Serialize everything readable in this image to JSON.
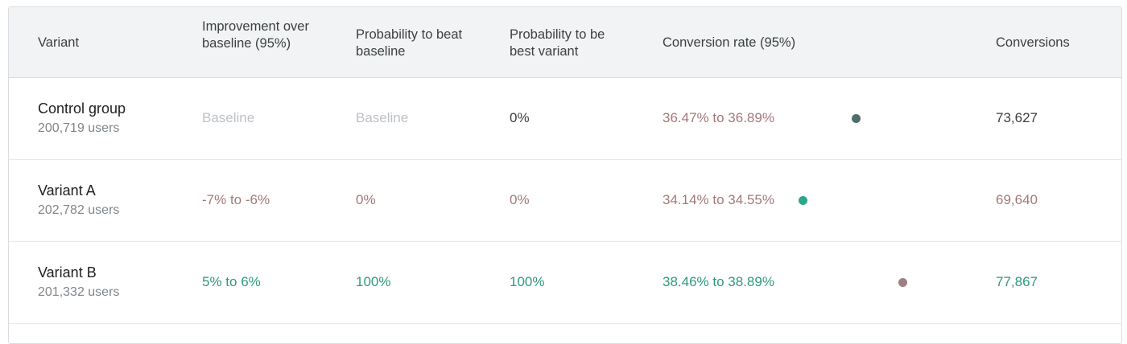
{
  "colors": {
    "header_bg": "#f1f3f4",
    "neutral_text": "#3c4043",
    "muted_text": "#bdc1c6",
    "negative_text": "#a5787b",
    "positive_text": "#2d9a7e",
    "dot_control": "#4f6e6b",
    "dot_variant_a": "#2aa889",
    "dot_variant_b": "#9e7f84"
  },
  "header": {
    "variant": "Variant",
    "improvement": "Improvement over baseline (95%)",
    "prob_beat": "Probability to beat baseline",
    "prob_best": "Probability to be best variant",
    "conversion_rate": "Conversion rate (95%)",
    "conversions": "Conversions"
  },
  "rows": [
    {
      "name": "Control group",
      "users": "200,719 users",
      "improvement": "Baseline",
      "prob_beat": "Baseline",
      "prob_best": "0%",
      "conversion_rate": "36.47% to 36.89%",
      "conversions": "73,627"
    },
    {
      "name": "Variant A",
      "users": "202,782 users",
      "improvement": "-7% to -6%",
      "prob_beat": "0%",
      "prob_best": "0%",
      "conversion_rate": "34.14% to 34.55%",
      "conversions": "69,640"
    },
    {
      "name": "Variant B",
      "users": "201,332 users",
      "improvement": "5% to 6%",
      "prob_beat": "100%",
      "prob_best": "100%",
      "conversion_rate": "38.46% to 38.89%",
      "conversions": "77,867"
    }
  ]
}
